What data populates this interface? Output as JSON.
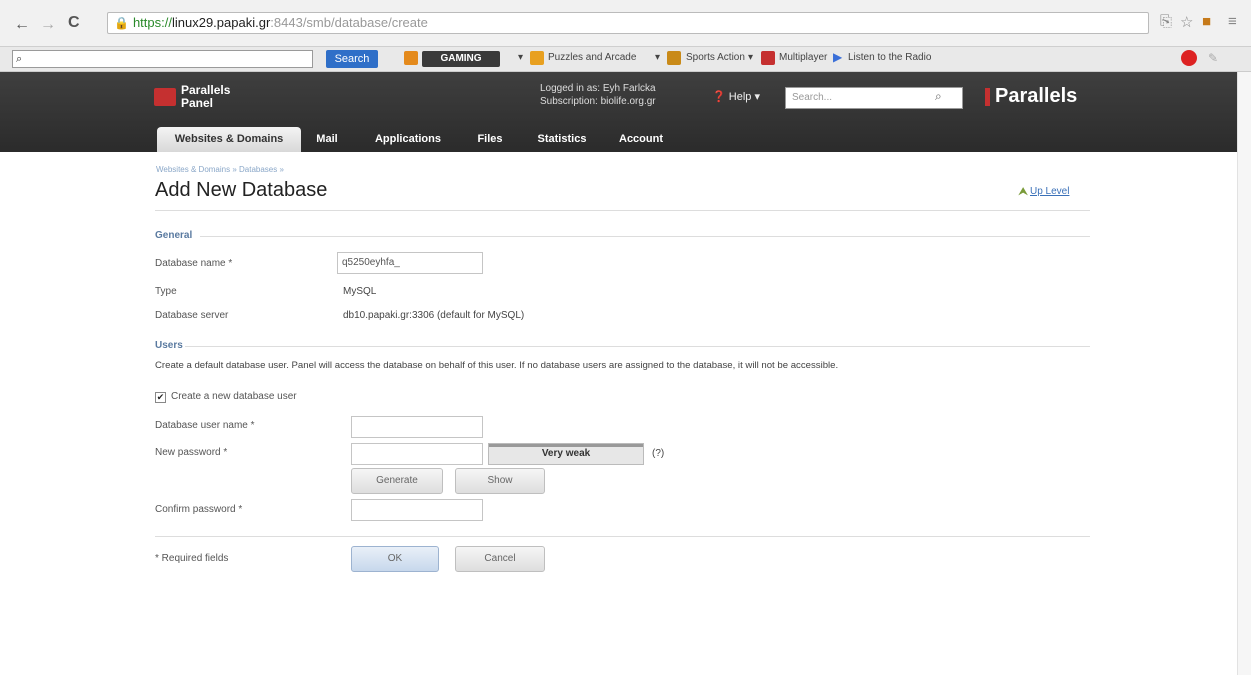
{
  "browser": {
    "url_scheme": "https://",
    "url_host": "linux29.papaki.gr",
    "url_path": ":8443/smb/database/create",
    "back_icon": "back-arrow-icon",
    "forward_icon": "forward-arrow-icon",
    "reload_icon": "reload-icon"
  },
  "toolbar": {
    "search_value": "",
    "search_label": "Search",
    "gaming": "GAMING",
    "items": [
      "Puzzles and Arcade",
      "Sports Action",
      "Multiplayer",
      "Listen to the Radio"
    ]
  },
  "panel": {
    "logo_line1": "Parallels",
    "logo_line2": "Panel",
    "logged_in": "Logged in as: Eyh Farlcka",
    "subscription": "Subscription: biolife.org.gr",
    "help": "Help",
    "search_placeholder": "Search...",
    "brand": "Parallels",
    "tabs": [
      "Websites & Domains",
      "Mail",
      "Applications",
      "Files",
      "Statistics",
      "Account"
    ]
  },
  "page": {
    "breadcrumb": "Websites & Domains » Databases »",
    "title": "Add New Database",
    "up_level": "Up Level",
    "general_heading": "General",
    "db_name_label": "Database name *",
    "db_name_value": "q5250eyhfa_",
    "type_label": "Type",
    "type_value": "MySQL",
    "server_label": "Database server",
    "server_value": "db10.papaki.gr:3306 (default for MySQL)",
    "users_heading": "Users",
    "users_desc": "Create a default database user. Panel will access the database on behalf of this user. If no database users are assigned to the database, it will not be accessible.",
    "create_user_label": "Create a new database user",
    "user_name_label": "Database user name *",
    "new_password_label": "New password *",
    "strength": "Very weak",
    "strength_help": "(?)",
    "generate": "Generate",
    "show": "Show",
    "confirm_label": "Confirm password *",
    "required": "* Required fields",
    "ok": "OK",
    "cancel": "Cancel"
  }
}
